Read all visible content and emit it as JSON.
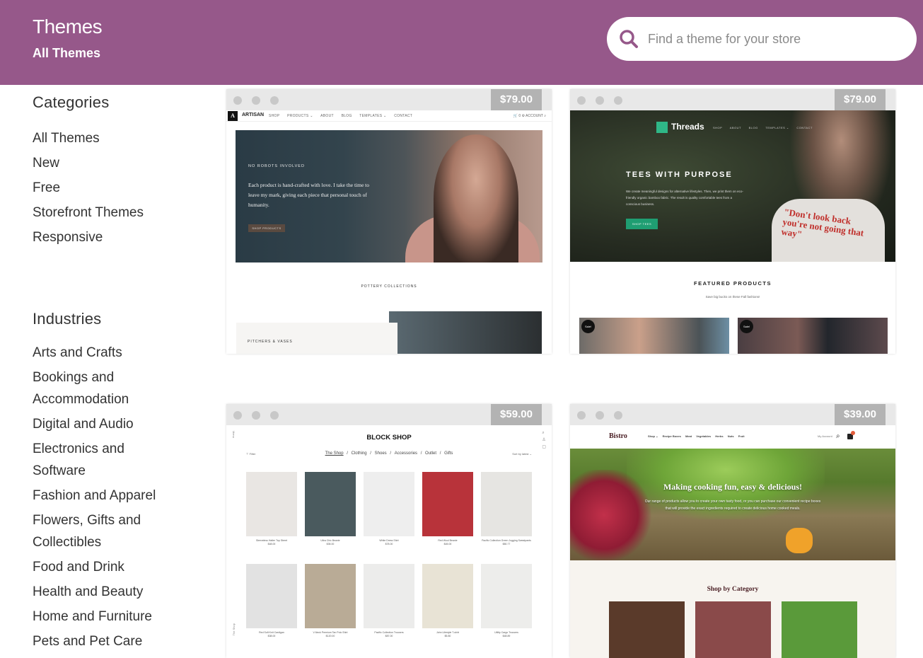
{
  "header": {
    "title": "Themes",
    "subtitle": "All Themes",
    "accent_color": "#96588a"
  },
  "search": {
    "placeholder": "Find a theme for your store",
    "value": "",
    "icon": "search-icon"
  },
  "sidebar": {
    "categories_title": "Categories",
    "categories": [
      "All Themes",
      "New",
      "Free",
      "Storefront Themes",
      "Responsive"
    ],
    "industries_title": "Industries",
    "industries": [
      "Arts and Crafts",
      "Bookings and Accommodation",
      "Digital and Audio",
      "Electronics and Software",
      "Fashion and Apparel",
      "Flowers, Gifts and Collectibles",
      "Food and Drink",
      "Health and Beauty",
      "Home and Furniture",
      "Pets and Pet Care"
    ]
  },
  "themes": [
    {
      "name": "Artisan",
      "price": "$79.00",
      "preview": {
        "logo": "ARTISAN",
        "logo_mark": "A",
        "nav": [
          "SHOP",
          "PRODUCTS ⌄",
          "ABOUT",
          "BLOG",
          "TEMPLATES ⌄",
          "CONTACT"
        ],
        "nav_right": "🛒 0   ⚙ ACCOUNT   ⌕",
        "eyebrow": "NO ROBOTS INVOLVED",
        "copy": "Each product is hand-crafted with love. I take the time to leave my mark, giving each piece that personal touch of humanity.",
        "button": "SHOP PRODUCTS",
        "section": "POTTERY COLLECTIONS",
        "panel": "PITCHERS & VASES"
      }
    },
    {
      "name": "Threads",
      "price": "$79.00",
      "preview": {
        "logo": "Threads",
        "nav": [
          "SHOP",
          "ABOUT",
          "BLOG",
          "TEMPLATES ⌄",
          "CONTACT"
        ],
        "headline": "TEES WITH PURPOSE",
        "copy": "We create meaningful designs for alternative lifestyles. Then, we print them on eco-friendly organic bamboo fabric. The result is quality comfortable tees from a conscious business.",
        "button": "SHOP TEES",
        "tee_text": "\"Don't look back you're not going that way\"",
        "featured_title": "FEATURED PRODUCTS",
        "featured_sub": "Save big bucks on these Fall fashions!",
        "sale_badge": "Sale!"
      }
    },
    {
      "name": "Block Shop",
      "price": "$59.00",
      "preview": {
        "title": "BLOCK SHOP",
        "nav": [
          "The Shop",
          "Clothing",
          "Shoes",
          "Accessories",
          "Outlet",
          "Gifts"
        ],
        "filter": "⊤ Filter",
        "sort": "Sort by latest ⌄",
        "menu": "Menu",
        "side_label": "The Shop",
        "products": [
          {
            "name": "Sleeveless Halter Top Street",
            "price": "$48.00",
            "color": "#e9e6e3"
          },
          {
            "name": "Ultra Chic Beanie",
            "price": "$35.00",
            "color": "#4a5a5e"
          },
          {
            "name": "White Dress Shirt",
            "price": "$78.00",
            "color": "#eeeeee"
          },
          {
            "name": "Red Wool Beanie",
            "price": "$45.00",
            "color": "#b8333a"
          },
          {
            "name": "Pacific Collection Green Jogging Sweatpants",
            "price": "$80.77",
            "color": "#e6e5e2"
          },
          {
            "name": "Red Soft Knit Cardigan",
            "price": "$38.00",
            "color": "#e2e2e2"
          },
          {
            "name": "V-Neck Premium Tan Polo Shirt",
            "price": "$120.00",
            "color": "#b9ab96"
          },
          {
            "name": "Pacific Collection Trousers",
            "price": "$87.00",
            "color": "#ececeb"
          },
          {
            "name": "John Lifestyle T-shirt",
            "price": "$5.80",
            "color": "#e8e3d5"
          },
          {
            "name": "Utility Cargo Trousers",
            "price": "$48.89",
            "color": "#ededeb"
          }
        ]
      }
    },
    {
      "name": "Bistro",
      "price": "$39.00",
      "preview": {
        "logo": "Bistro",
        "nav": [
          "Shop ⌄",
          "Recipe Boxes",
          "Meat",
          "Vegetables",
          "Herbs",
          "Nuts",
          "Fruit"
        ],
        "account": "My Account",
        "headline": "Making cooking fun, easy & delicious!",
        "copy": "Our range of products allow you to create your own tasty food, or you can purchase our convenient recipe boxes that will provide the exact ingredients required to create delicious home cooked meals.",
        "section": "Shop by Category",
        "categories": [
          {
            "color": "#5a3a2a"
          },
          {
            "color": "#8a4a4a"
          },
          {
            "color": "#5a9a3a"
          }
        ]
      }
    }
  ]
}
